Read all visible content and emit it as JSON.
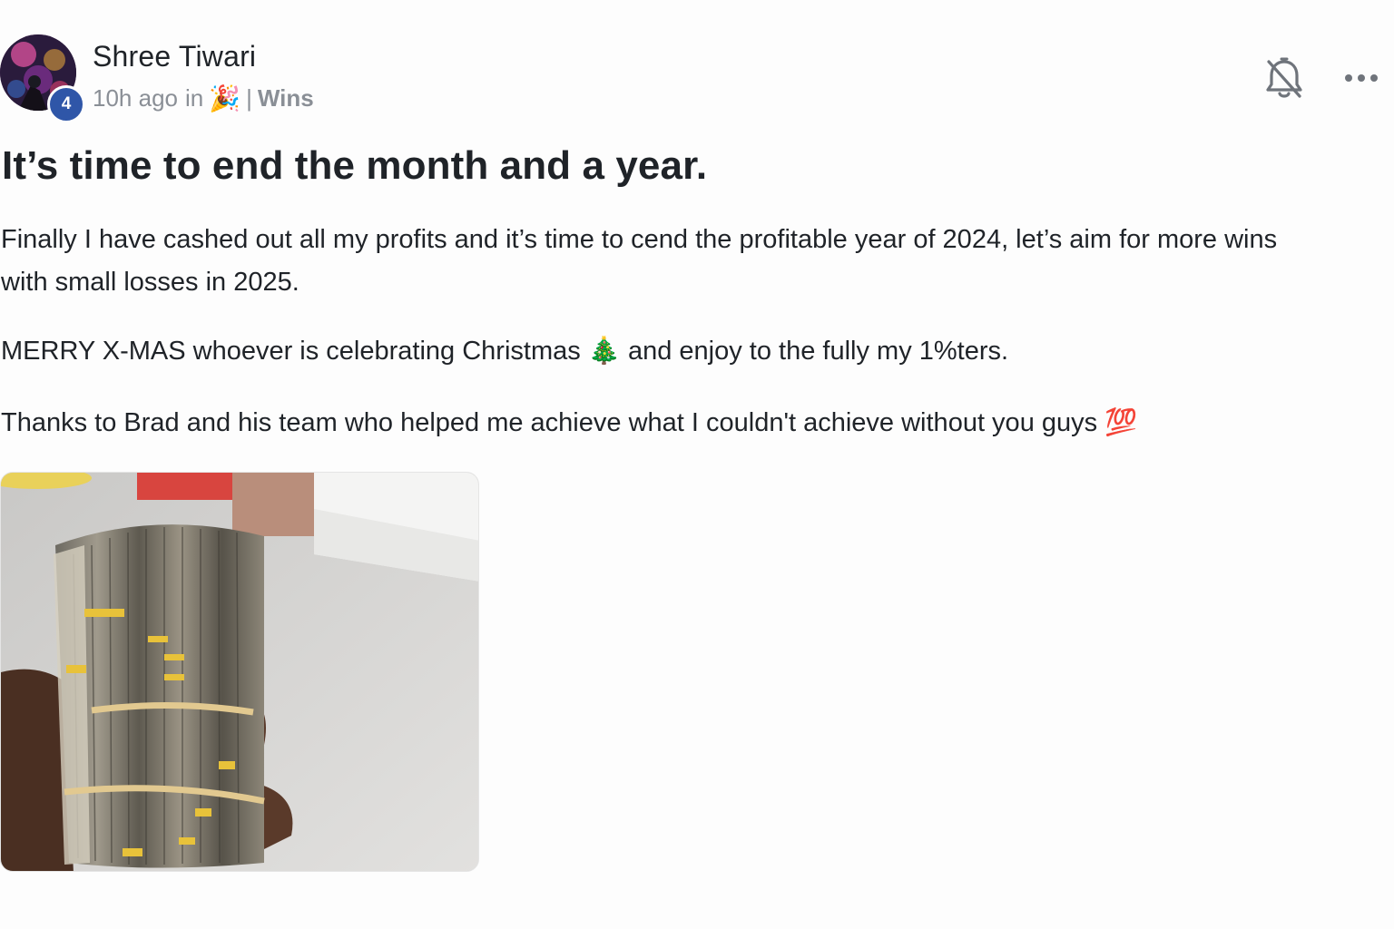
{
  "post": {
    "author": {
      "name": "Shree Tiwari",
      "level": "4"
    },
    "meta": {
      "time_ago": "10h ago",
      "in_word": "in",
      "category_icon": "party-popper-icon",
      "category_emoji": "🎉",
      "separator": "|",
      "channel": "Wins"
    },
    "actions": {
      "bell_icon": "bell-off-icon",
      "more_icon": "more-horizontal-icon"
    },
    "title": "It’s time to end the month and a year.",
    "paragraphs": {
      "p1": "Finally I have cashed out all my profits and it’s time to cend the profitable year of 2024, let’s aim for more wins with small losses in 2025.",
      "p2_before": "MERRY X-MAS whoever is celebrating Christmas ",
      "p2_emoji": "🎄",
      "p2_after": " and enjoy to the fully my 1%ters.",
      "p3_text": "Thanks to Brad and his team who helped me achieve what I couldn't achieve without you guys ",
      "p3_emoji": "💯"
    },
    "image": {
      "icon": "cash-stack-photo"
    }
  }
}
